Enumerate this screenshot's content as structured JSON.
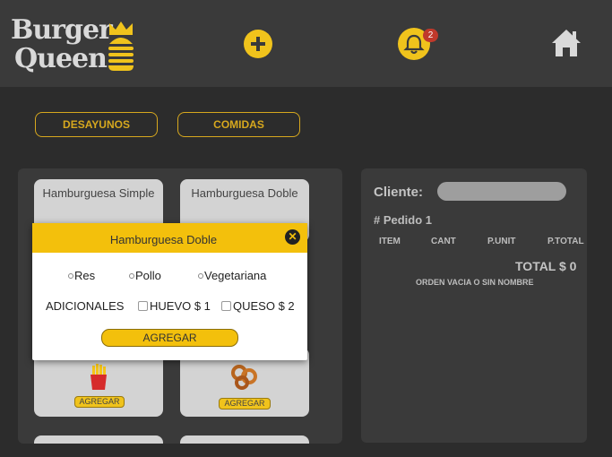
{
  "header": {
    "logo_line1": "Burger",
    "logo_line2": "Queen",
    "notifications_count": "2",
    "icons": [
      "plus-circle-icon",
      "bell-icon",
      "home-icon",
      "burger-crown-logo"
    ]
  },
  "categories": [
    {
      "label": "DESAYUNOS"
    },
    {
      "label": "COMIDAS"
    }
  ],
  "menu": {
    "items": [
      {
        "name": "Hamburguesa Simple"
      },
      {
        "name": "Hamburguesa Doble"
      },
      {
        "name": "Papas fritas",
        "action": "AGREGAR"
      },
      {
        "name": "Aros de cebolla",
        "action": "AGREGAR"
      }
    ]
  },
  "order": {
    "client_label": "Cliente:",
    "client_value": "",
    "order_number": "# Pedido 1",
    "columns": [
      "ITEM",
      "CANT",
      "P.UNIT",
      "P.TOTAL"
    ],
    "total_label": "TOTAL $ 0",
    "empty_text": "ORDEN VACIA O SIN NOMBRE"
  },
  "modal": {
    "title": "Hamburguesa Doble",
    "options": [
      "Res",
      "Pollo",
      "Vegetariana"
    ],
    "extras_label": "ADICIONALES",
    "extras": [
      "HUEVO $ 1",
      "QUESO $ 2"
    ],
    "add_label": "AGREGAR"
  },
  "colors": {
    "accent": "#f0c31c",
    "background": "#2c2c2c",
    "panel": "#3a3a3a",
    "badge": "#c0392b"
  }
}
